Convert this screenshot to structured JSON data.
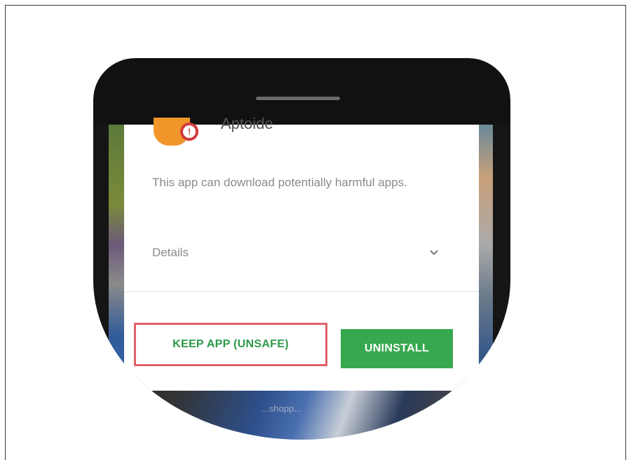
{
  "dialog": {
    "app_name": "Aptoide",
    "message": "This app can download potentially harmful apps.",
    "details_label": "Details",
    "keep_button_label": "KEEP APP (UNSAFE)",
    "uninstall_button_label": "UNINSTALL"
  },
  "wallpaper": {
    "text": "...shopp..."
  },
  "icons": {
    "app": "aptoide-app-icon",
    "badge": "warning-shield-icon",
    "expand": "chevron-down-icon"
  },
  "colors": {
    "keep_text": "#2e9a4a",
    "keep_highlight_border": "#e0606a",
    "uninstall_bg": "#37a84f",
    "app_icon": "#f0962a",
    "badge": "#d23a3a"
  }
}
